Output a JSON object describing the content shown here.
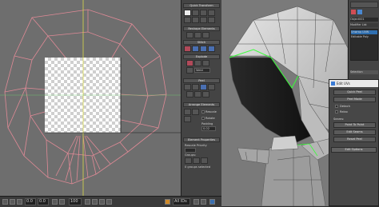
{
  "tool_panel": {
    "quick_transform": "Quick Transform",
    "reshape_elements": "Reshape Elements",
    "stitch": "Stitch",
    "explode": "Explode",
    "weld": "Weld",
    "peel": "Peel",
    "arrange_elements": "Arrange Elements",
    "rescale_label": "Rescale",
    "rotate_label": "Rotate",
    "padding_label": "Padding",
    "padding_value": "0.02",
    "element_properties": "Element Properties",
    "rescale_priority": "Rescale Priority",
    "groups_label": "Groups:",
    "no_groups": "0 groups selected"
  },
  "bottom_bar": {
    "zoom_value": "100",
    "u_value": "0.0",
    "v_value": "0.0",
    "all_ids": "All IDs"
  },
  "command_panel": {
    "object_name": "Object001",
    "modifier_list": "Modifier List",
    "stack_items": [
      "Unwrap UVW",
      "Editable Poly"
    ],
    "selection_label": "Selection"
  },
  "peel_dialog": {
    "title": "Edit UVs",
    "quick_peel": "Quick Peel",
    "peel_mode": "Peel Mode",
    "detach": "Detach",
    "relax": "Relax",
    "seams_label": "Seams:",
    "point_to_point": "Point To Point",
    "edit_seams": "Edit Seams",
    "reset_peel": "Reset Peel",
    "edit_options": "Edit Options"
  },
  "colors": {
    "uv_background": "#6e6e6e",
    "uv_edges": "#e08a96",
    "axis_yellow": "#d8d84a",
    "axis_green": "#6fcf6f",
    "selection_green": "#39ff39",
    "mesh_light": "#cfcfcf",
    "mesh_dark": "#1e1e1e",
    "dialog_title_bg": "#e9e9e9",
    "selection_blue": "#2f6fb0"
  }
}
